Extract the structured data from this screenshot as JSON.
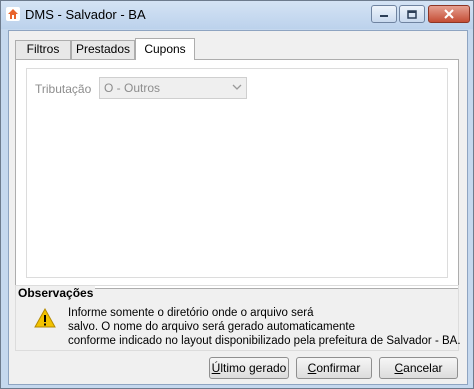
{
  "window": {
    "title": "DMS - Salvador - BA",
    "icon": "app-icon"
  },
  "titlebar_buttons": {
    "minimize": "minimize-icon",
    "maximize": "maximize-icon",
    "close": "close-icon"
  },
  "tabs": [
    {
      "label": "Filtros",
      "active": false
    },
    {
      "label": "Prestados",
      "active": false
    },
    {
      "label": "Cupons",
      "active": true
    }
  ],
  "form": {
    "tributacao_label": "Tributação",
    "tributacao_value": "O - Outros",
    "tributacao_enabled": false
  },
  "observacoes": {
    "title": "Observações",
    "icon": "warning-icon",
    "lines": [
      "Informe somente o diretório onde o arquivo será",
      "salvo. O nome do arquivo será gerado automaticamente",
      "conforme indicado no layout disponibilizado pela prefeitura de Salvador - BA."
    ]
  },
  "buttons": {
    "ultimo_gerado_first": "Ú",
    "ultimo_gerado_rest": "ltimo gerado",
    "confirmar_first": "C",
    "confirmar_rest": "onfirmar",
    "cancelar_first": "C",
    "cancelar_rest": "ancelar"
  },
  "colors": {
    "close_button": "#c44d35",
    "window_frame": "#c5d8ee",
    "warning": "#f2c200"
  }
}
